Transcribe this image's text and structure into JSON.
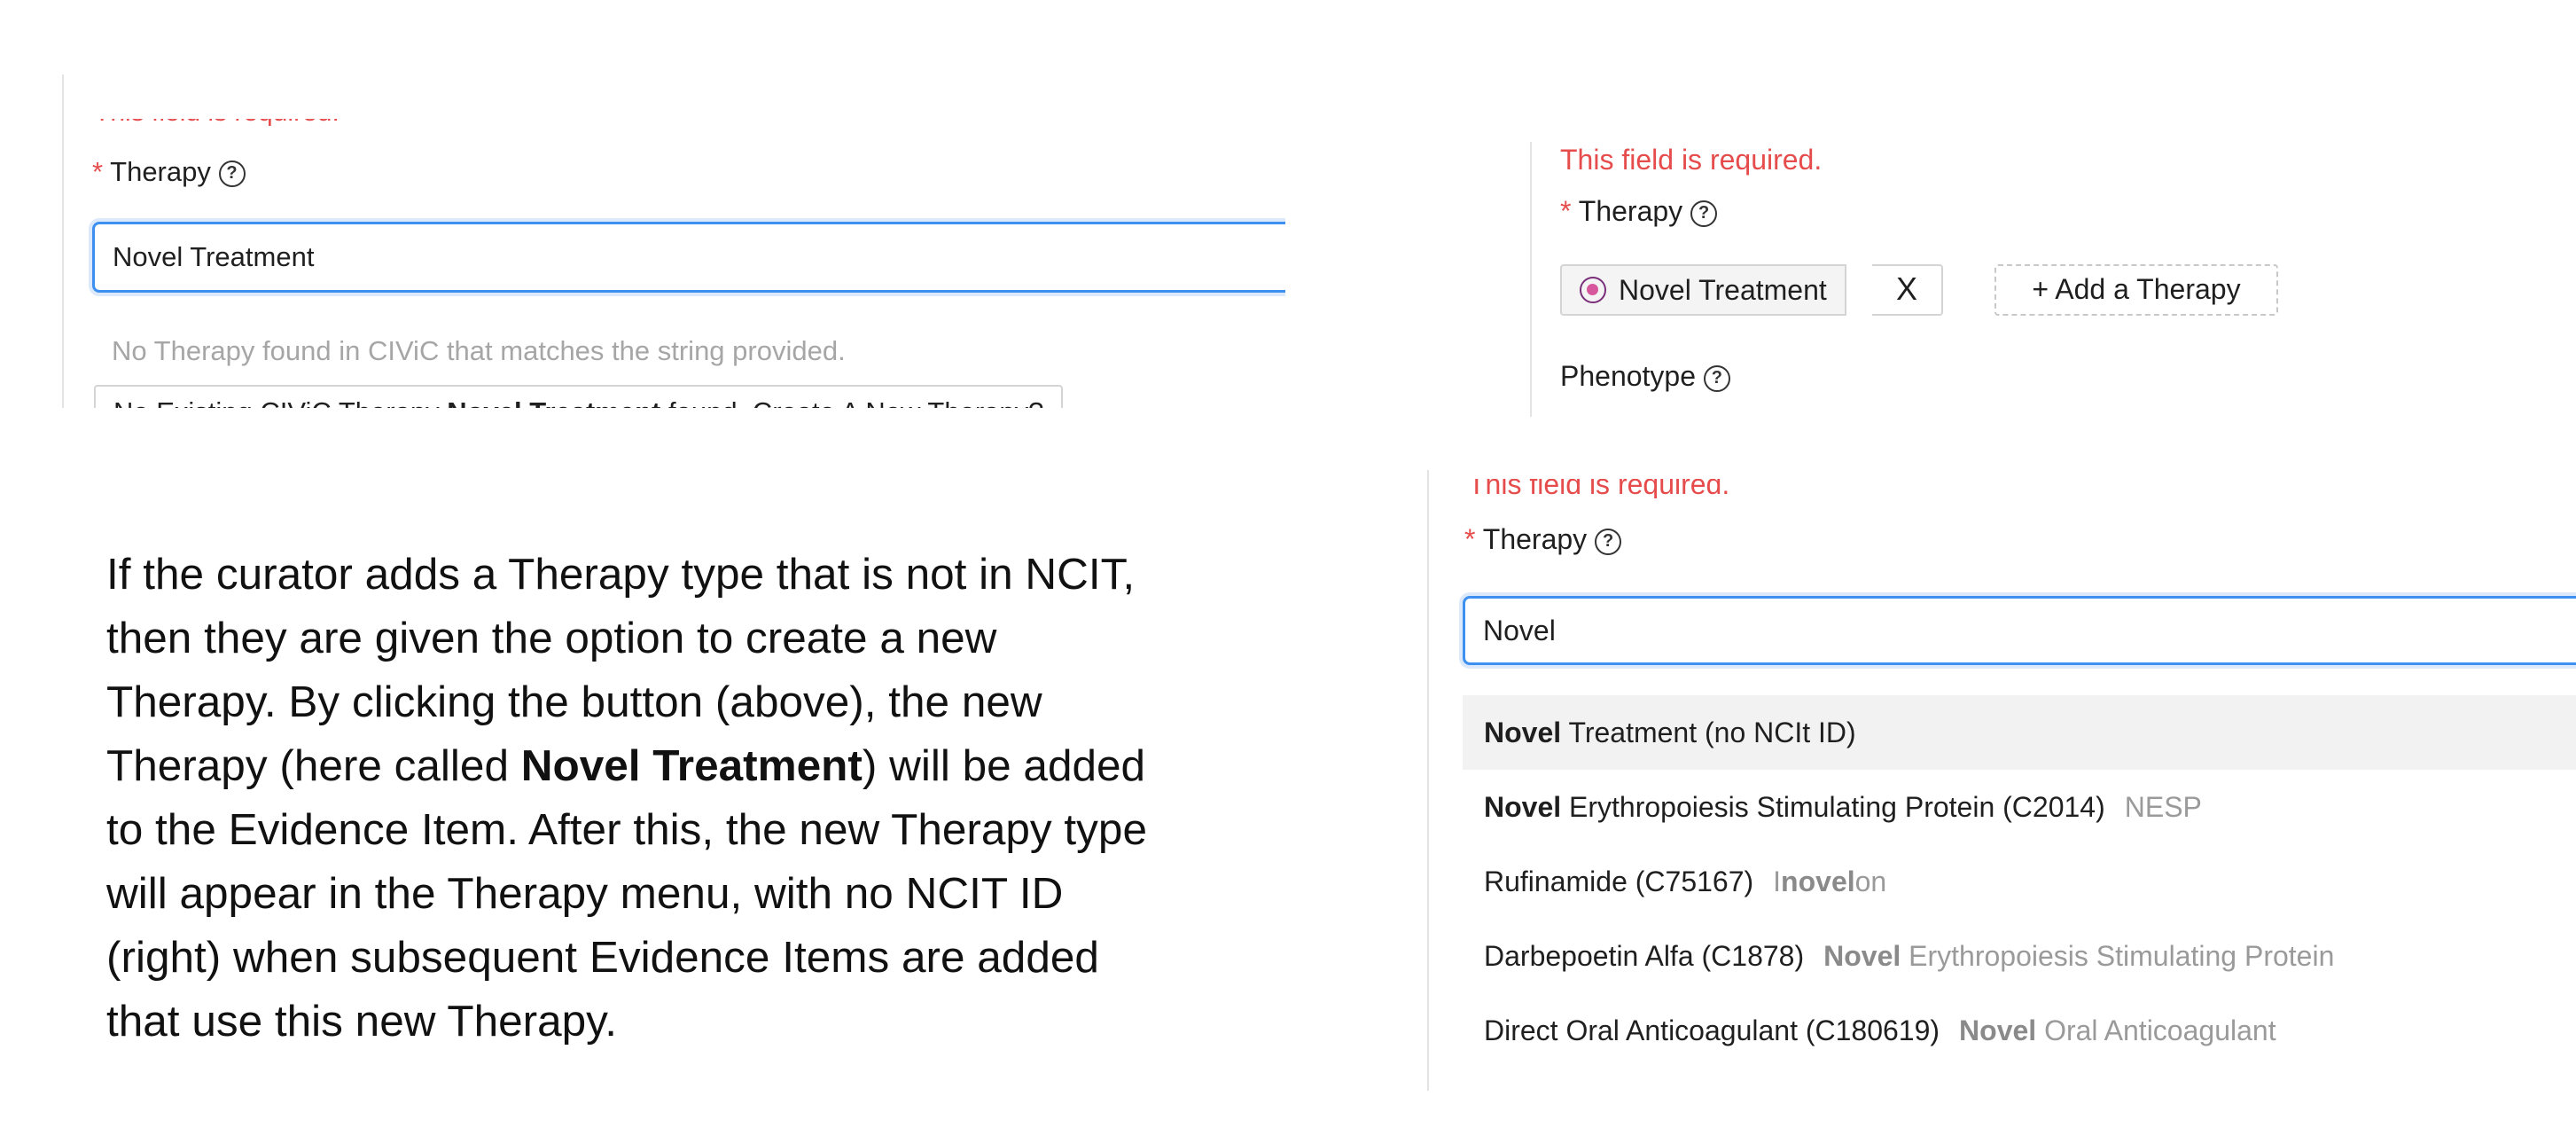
{
  "panel_create": {
    "error_text": "This field is required.",
    "label": "Therapy",
    "input_value": "Novel Treatment",
    "no_match_text": "No Therapy found in CIViC that matches the string provided.",
    "create_prefix": "No Existing CIViC Therapy ",
    "create_term": "Novel Treatment",
    "create_suffix": " found. Create A New Therapy?"
  },
  "panel_added": {
    "error_text": "This field is required.",
    "label": "Therapy",
    "tag_label": "Novel Treatment",
    "remove_glyph": "X",
    "add_button": "+ Add a Therapy",
    "phenotype_label": "Phenotype"
  },
  "panel_search": {
    "error_text": "This field is required.",
    "label": "Therapy",
    "input_value": "Novel",
    "options": [
      {
        "bold": "Novel",
        "rest": " Treatment (no NCIt ID)",
        "syn_pre": "",
        "syn_bold": "",
        "syn_post": ""
      },
      {
        "bold": "Novel",
        "rest": " Erythropoiesis Stimulating Protein (C2014)",
        "syn_pre": "NESP",
        "syn_bold": "",
        "syn_post": ""
      },
      {
        "bold": "",
        "rest": "Rufinamide (C75167)",
        "syn_pre": "I",
        "syn_bold": "novel",
        "syn_post": "on"
      },
      {
        "bold": "",
        "rest": "Darbepoetin Alfa (C1878)",
        "syn_pre": "",
        "syn_bold": "Novel",
        "syn_post": " Erythropoiesis Stimulating Protein"
      },
      {
        "bold": "",
        "rest": "Direct Oral Anticoagulant (C180619)",
        "syn_pre": "",
        "syn_bold": "Novel",
        "syn_post": " Oral Anticoagulant"
      }
    ]
  },
  "description": {
    "line1": "If the curator adds a Therapy type that is not in NCIT,",
    "line2": "then they are given the option to create a new",
    "line3": "Therapy. By clicking the button (above), the new",
    "line4_pre": "Therapy (here called ",
    "line4_bold": "Novel Treatment",
    "line4_post": ") will be added",
    "line5": "to the Evidence Item. After this, the new Therapy type",
    "line6": "will appear in the Therapy menu, with no NCIT ID",
    "line7": "(right) when subsequent Evidence Items are added",
    "line8": "that use this new Therapy."
  },
  "colors": {
    "error_red": "#e64c4c",
    "focus_blue": "#3d8ff0",
    "tag_icon": "#d7579d"
  },
  "icons": [
    "question-circle-icon",
    "therapy-icon",
    "close-icon",
    "plus-icon"
  ]
}
